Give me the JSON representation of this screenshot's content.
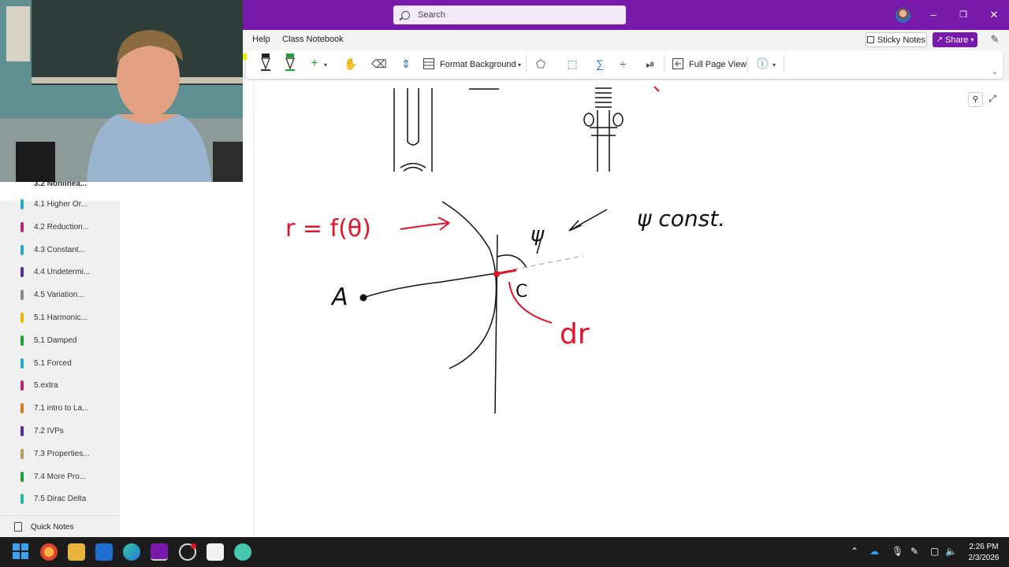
{
  "titlebar": {
    "search_placeholder": "Search",
    "accent_color": "#7719aa"
  },
  "ribbon": {
    "tabs": [
      "Help",
      "Class Notebook"
    ],
    "sticky_notes_label": "Sticky Notes",
    "share_label": "Share"
  },
  "toolbar": {
    "format_background_label": "Format Background",
    "full_page_view_label": "Full Page View"
  },
  "sidebar": {
    "partial_item_label": "3.2 Nonlinea...",
    "items": [
      {
        "label": "4.1 Higher Or...",
        "color": "#2aa8c7"
      },
      {
        "label": "4.2 Reduction...",
        "color": "#b4287a"
      },
      {
        "label": "4.3 Constant...",
        "color": "#2aa8c7"
      },
      {
        "label": "4.4 Undetermi...",
        "color": "#5b2c8f"
      },
      {
        "label": "4.5 Variation...",
        "color": "#8a8a8a"
      },
      {
        "label": "5.1 Harmonic...",
        "color": "#e6b800"
      },
      {
        "label": "5.1 Damped",
        "color": "#1e9e3a"
      },
      {
        "label": "5.1 Forced",
        "color": "#2aa8c7"
      },
      {
        "label": "5.extra",
        "color": "#b4287a"
      },
      {
        "label": "7.1 intro to La...",
        "color": "#e07a1e"
      },
      {
        "label": "7.2 IVPs",
        "color": "#5b2c8f"
      },
      {
        "label": "7.3 Properties...",
        "color": "#b59a6a"
      },
      {
        "label": "7.4 More Pro...",
        "color": "#1e9e3a"
      },
      {
        "label": "7.5 Dirac Delta",
        "color": "#2ab8a0"
      }
    ],
    "quick_notes_label": "Quick Notes"
  },
  "ink": {
    "equation": "r = f(θ)",
    "psi": "ψ",
    "psi_const": "ψ const.",
    "label_a": "A",
    "label_c": "C",
    "label_dr": "dr",
    "red": "#e0152a",
    "black": "#111111"
  },
  "taskbar": {
    "time": "2:26 PM",
    "date": "2/3/2026"
  }
}
